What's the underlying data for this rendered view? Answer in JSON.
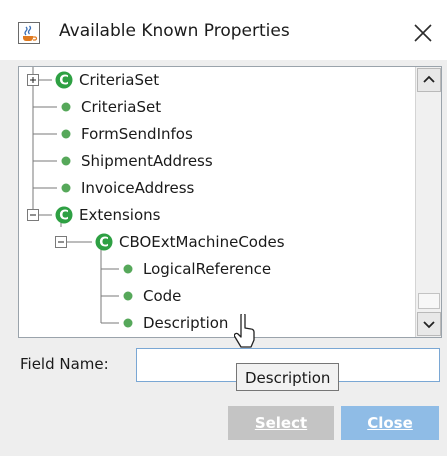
{
  "window": {
    "title": "Available Known Properties",
    "icon": "java-coffee-icon"
  },
  "tree": {
    "items": [
      {
        "label": "CriteriaSet",
        "level": 0,
        "kind": "class",
        "expander": "plus"
      },
      {
        "label": "CriteriaSet",
        "level": 1,
        "kind": "property"
      },
      {
        "label": "FormSendInfos",
        "level": 1,
        "kind": "property"
      },
      {
        "label": "ShipmentAddress",
        "level": 1,
        "kind": "property"
      },
      {
        "label": "InvoiceAddress",
        "level": 1,
        "kind": "property"
      },
      {
        "label": "Extensions",
        "level": 0,
        "kind": "class",
        "expander": "minus"
      },
      {
        "label": "CBOExtMachineCodes",
        "level": 1,
        "kind": "class",
        "expander": "minus"
      },
      {
        "label": "LogicalReference",
        "level": 2,
        "kind": "property"
      },
      {
        "label": "Code",
        "level": 2,
        "kind": "property"
      },
      {
        "label": "Description",
        "level": 2,
        "kind": "property"
      }
    ],
    "class_badge_letter": "C",
    "colors": {
      "class_badge": "#2ea043",
      "property_dot": "#56a85a",
      "connector": "#7a7a7a"
    }
  },
  "field": {
    "label": "Field Name:",
    "value": ""
  },
  "tooltip": {
    "text": "Description"
  },
  "buttons": {
    "select": {
      "label": "Select",
      "enabled": false,
      "color": "#c4c4c4"
    },
    "close": {
      "label": "Close",
      "enabled": true,
      "color": "#8fbce6"
    }
  }
}
